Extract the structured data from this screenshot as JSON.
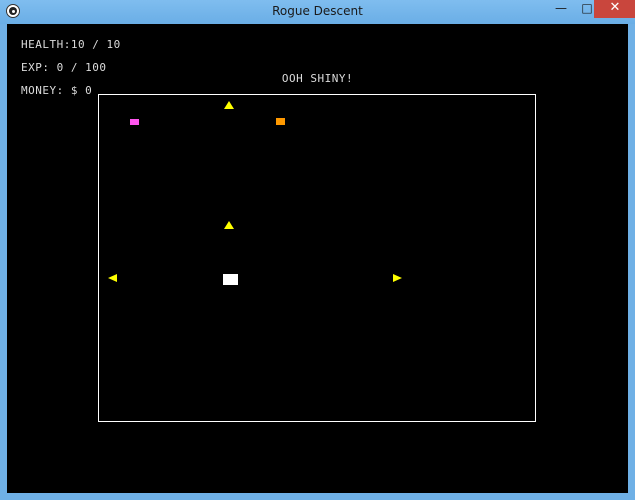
{
  "window": {
    "title": "Rogue Descent",
    "minimize_glyph": "—",
    "maximize_glyph": "□",
    "close_glyph": "✕"
  },
  "hud": {
    "health_label": "HEALTH:",
    "health_value": "10 / 10",
    "exp_label": "EXP:",
    "exp_value": "0 / 100",
    "money_label": "MONEY:",
    "money_value": "$ 0"
  },
  "message": "OOH SHINY!",
  "colors": {
    "enemy": "#ffff00",
    "item_magenta": "#ff55ee",
    "item_orange": "#ff9900",
    "player": "#ffffff",
    "background": "#000000"
  },
  "entities": {
    "enemy_icon": "yellow-triangle",
    "player_icon": "white-square",
    "item_icons": [
      "magenta-square",
      "orange-square"
    ]
  }
}
